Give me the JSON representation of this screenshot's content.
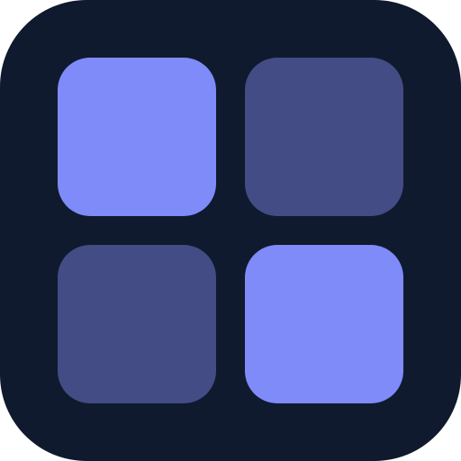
{
  "icon": {
    "name": "grid-icon",
    "colors": {
      "background": "#0F1A2E",
      "tile_light": "#7F8BF8",
      "tile_dark": "#434C85"
    },
    "tiles": [
      {
        "position": "top-left",
        "tone": "light"
      },
      {
        "position": "top-right",
        "tone": "dark"
      },
      {
        "position": "bottom-left",
        "tone": "dark"
      },
      {
        "position": "bottom-right",
        "tone": "light"
      }
    ]
  }
}
